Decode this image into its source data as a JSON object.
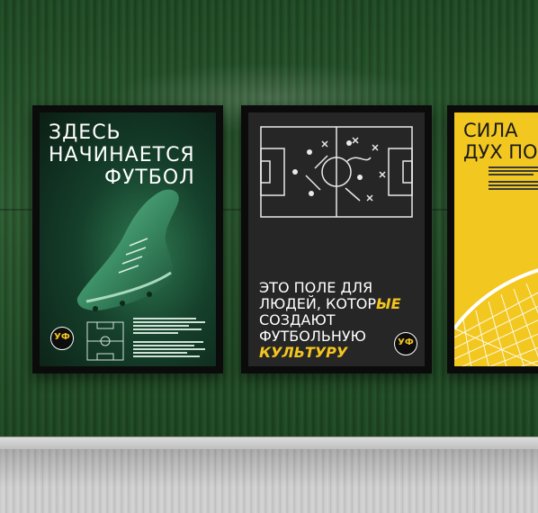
{
  "scene": {
    "wall_color": "#245329",
    "floor_color": "#cfcfcf",
    "accent_yellow": "#f3c520"
  },
  "posters": [
    {
      "title_lines": [
        "Здесь",
        "начинается",
        "футбол"
      ],
      "background": "#15402b",
      "logo": "УФ",
      "image": "football-boot-icon"
    },
    {
      "headline_lines": [
        "Это поле для",
        "людей, котор",
        "ые",
        "создают",
        "футбольную",
        "культуру"
      ],
      "background": "#262626",
      "logo": "УФ",
      "image": "tactics-board"
    },
    {
      "title_lines": [
        "Сила",
        "дух по"
      ],
      "background": "#f2c71f",
      "image": "goal-net"
    }
  ]
}
